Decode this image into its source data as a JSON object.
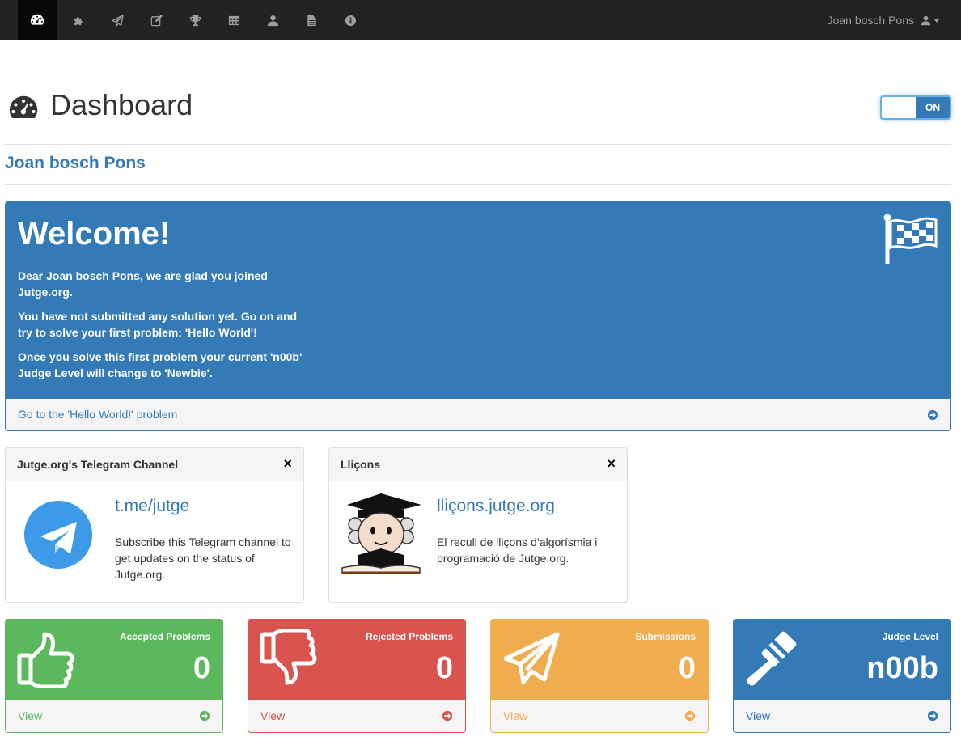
{
  "user": {
    "name": "Joan bosch Pons"
  },
  "nav": {
    "items": [
      {
        "name": "dashboard",
        "icon": "dashboard-icon"
      },
      {
        "name": "problems",
        "icon": "puzzle-icon"
      },
      {
        "name": "submissions",
        "icon": "send-icon"
      },
      {
        "name": "courses",
        "icon": "edit-icon"
      },
      {
        "name": "competitions",
        "icon": "trophy-icon"
      },
      {
        "name": "lists",
        "icon": "table-icon"
      },
      {
        "name": "profile",
        "icon": "user-icon"
      },
      {
        "name": "documents",
        "icon": "file-icon"
      },
      {
        "name": "about",
        "icon": "info-icon"
      }
    ]
  },
  "header": {
    "title": "Dashboard",
    "toggle_label": "ON"
  },
  "welcome": {
    "title": "Welcome!",
    "p1": "Dear Joan bosch Pons, we are glad you joined Jutge.org.",
    "p2": "You have not submitted any solution yet. Go on and try to solve your first problem: 'Hello World'!",
    "p3": "Once you solve this first problem your current 'n00b' Judge Level will change to 'Newbie'.",
    "link": "Go to the 'Hello World!' problem"
  },
  "telegram": {
    "title": "Jutge.org's Telegram Channel",
    "close": "×",
    "link": "t.me/jutge",
    "text": "Subscribe this Telegram channel to get updates on the status of Jutge.org."
  },
  "llicons": {
    "title": "Lliçons",
    "close": "×",
    "link": "lliçons.jutge.org",
    "text": "El recull de lliçons d’algorísmia i programació de Jutge.org."
  },
  "stats": [
    {
      "label": "Accepted Problems",
      "value": "0",
      "footer": "View",
      "color": "#5cb85c",
      "icon": "thumbs-up-icon"
    },
    {
      "label": "Rejected Problems",
      "value": "0",
      "footer": "View",
      "color": "#d9534f",
      "icon": "thumbs-down-icon"
    },
    {
      "label": "Submissions",
      "value": "0",
      "footer": "View",
      "color": "#f0ad4e",
      "icon": "paper-plane-icon"
    },
    {
      "label": "Judge Level",
      "value": "n00b",
      "footer": "View",
      "color": "#337ab7",
      "icon": "gavel-icon"
    }
  ],
  "colors": {
    "primary": "#337ab7",
    "navbar": "#222222"
  }
}
